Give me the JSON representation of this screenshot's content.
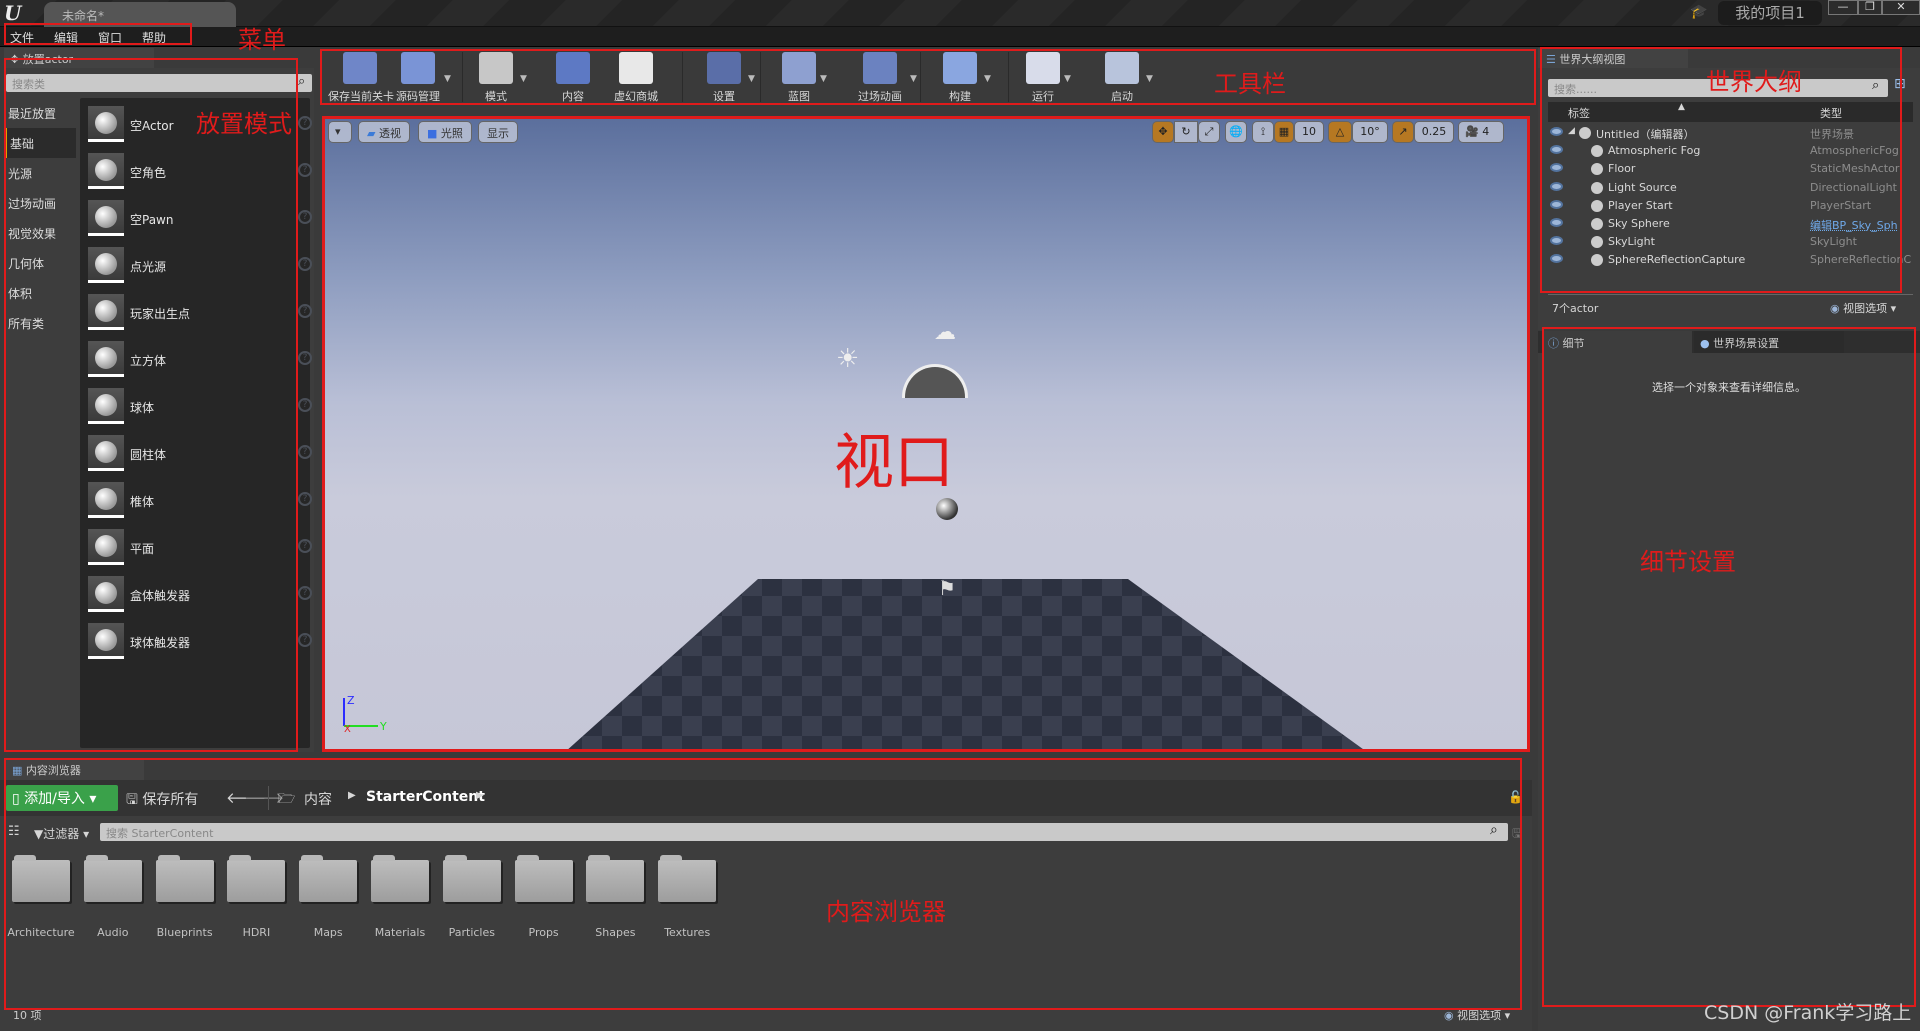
{
  "window": {
    "document_tab": "未命名*",
    "project_name": "我的项目1",
    "window_buttons": [
      "minimize",
      "restore",
      "close"
    ]
  },
  "menu": {
    "items": [
      "文件",
      "编辑",
      "窗口",
      "帮助"
    ]
  },
  "annotations": {
    "menu": "菜单",
    "place_mode": "放置模式",
    "toolbar": "工具栏",
    "viewport": "视口",
    "world_outliner": "世界大纲",
    "details": "细节设置",
    "content_browser": "内容浏览器"
  },
  "place_panel": {
    "tab_title": "放置actor",
    "search_placeholder": "搜索类",
    "categories": [
      "最近放置",
      "基础",
      "光源",
      "过场动画",
      "视觉效果",
      "几何体",
      "体积",
      "所有类"
    ],
    "active_category": "基础",
    "items": [
      "空Actor",
      "空角色",
      "空Pawn",
      "点光源",
      "玩家出生点",
      "立方体",
      "球体",
      "圆柱体",
      "椎体",
      "平面",
      "盒体触发器",
      "球体触发器"
    ]
  },
  "toolbar": {
    "buttons": [
      {
        "label": "保存当前关卡",
        "icon": "save-icon",
        "dropdown": false
      },
      {
        "label": "源码管理",
        "icon": "source-control-icon",
        "dropdown": true
      },
      {
        "label": "模式",
        "icon": "modes-icon",
        "dropdown": true
      },
      {
        "label": "内容",
        "icon": "content-icon",
        "dropdown": false
      },
      {
        "label": "虚幻商城",
        "icon": "marketplace-icon",
        "dropdown": false
      },
      {
        "label": "设置",
        "icon": "settings-icon",
        "dropdown": true
      },
      {
        "label": "蓝图",
        "icon": "blueprint-icon",
        "dropdown": true
      },
      {
        "label": "过场动画",
        "icon": "cinematics-icon",
        "dropdown": true
      },
      {
        "label": "构建",
        "icon": "build-icon",
        "dropdown": true
      },
      {
        "label": "运行",
        "icon": "play-icon",
        "dropdown": true
      },
      {
        "label": "启动",
        "icon": "launch-icon",
        "dropdown": true
      }
    ]
  },
  "viewport": {
    "left_buttons": [
      "透视",
      "光照",
      "显示"
    ],
    "grid_snap": "10",
    "rotation_snap": "10°",
    "scale_snap": "0.25",
    "camera_speed": "4",
    "axis_labels": {
      "z": "Z",
      "x": "X",
      "y": "Y"
    }
  },
  "outliner": {
    "tab_title": "世界大纲视图",
    "search_placeholder": "搜索......",
    "col_label": "标签",
    "col_type": "类型",
    "rows": [
      {
        "name": "Untitled（编辑器）",
        "type": "世界场景",
        "link": false
      },
      {
        "name": "Atmospheric Fog",
        "type": "AtmosphericFog",
        "link": false
      },
      {
        "name": "Floor",
        "type": "StaticMeshActor",
        "link": false
      },
      {
        "name": "Light Source",
        "type": "DirectionalLight",
        "link": false
      },
      {
        "name": "Player Start",
        "type": "PlayerStart",
        "link": false
      },
      {
        "name": "Sky Sphere",
        "type": "编辑BP_Sky_Sph",
        "link": true
      },
      {
        "name": "SkyLight",
        "type": "SkyLight",
        "link": false
      },
      {
        "name": "SphereReflectionCapture",
        "type": "SphereReflectionC",
        "link": false
      }
    ],
    "actor_count": "7个actor",
    "view_options": "视图选项"
  },
  "details": {
    "tabs": [
      "细节",
      "世界场景设置"
    ],
    "empty_message": "选择一个对象来查看详细信息。"
  },
  "content_browser": {
    "tab_title": "内容浏览器",
    "add_import": "添加/导入",
    "save_all": "保存所有",
    "breadcrumb": [
      "内容",
      "StarterContent"
    ],
    "filters": "过滤器",
    "search_placeholder": "搜索 StarterContent",
    "folders": [
      "Architecture",
      "Audio",
      "Blueprints",
      "HDRI",
      "Maps",
      "Materials",
      "Particles",
      "Props",
      "Shapes",
      "Textures"
    ],
    "item_count": "10 项",
    "view_options": "视图选项"
  },
  "watermark": "CSDN @Frank学习路上",
  "colors": {
    "accent_orange": "#b67822",
    "add_green": "#3aa14a",
    "annotation_red": "#e01b1b",
    "link_blue": "#6fa8e8"
  }
}
